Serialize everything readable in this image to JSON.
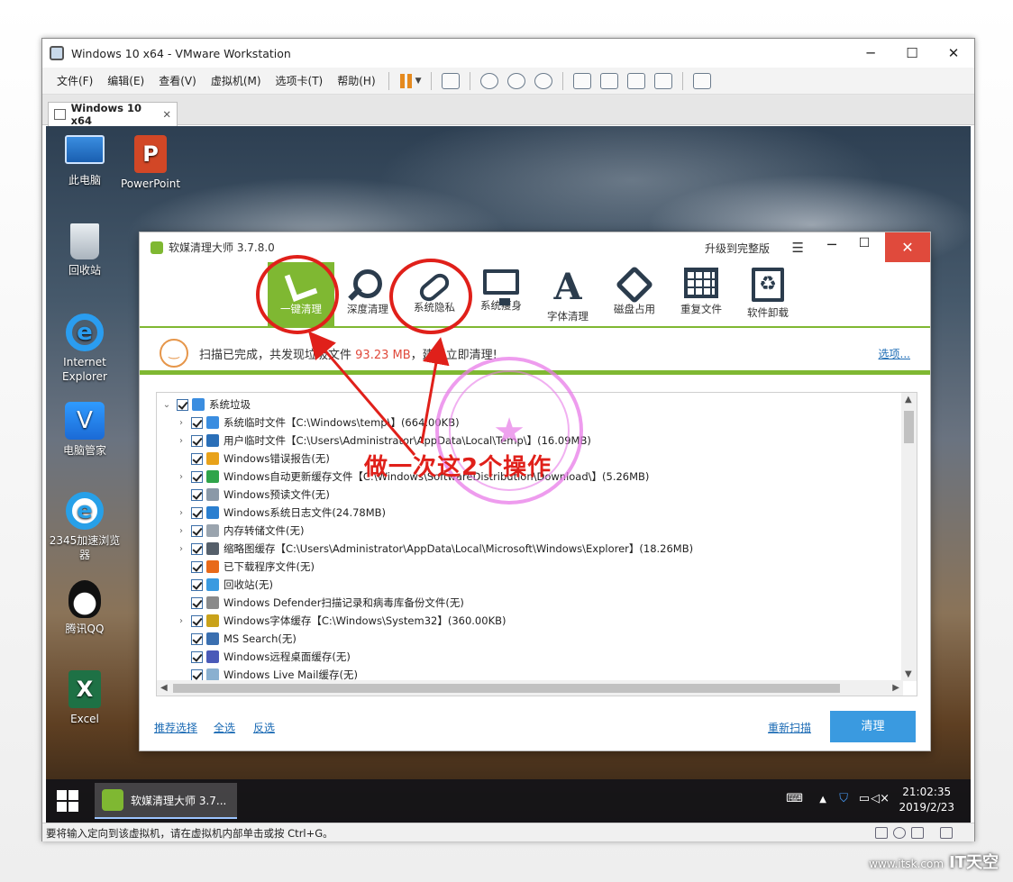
{
  "vmware": {
    "title": "Windows 10 x64 - VMware Workstation",
    "menus": [
      "文件(F)",
      "编辑(E)",
      "查看(V)",
      "虚拟机(M)",
      "选项卡(T)",
      "帮助(H)"
    ],
    "tab": "Windows 10 x64",
    "statusbar": "要将输入定向到该虚拟机，请在虚拟机内部单击或按 Ctrl+G。"
  },
  "desktop": {
    "icons": [
      {
        "label": "此电脑",
        "icon": "computer-icon"
      },
      {
        "label": "PowerPoint",
        "icon": "powerpoint-icon"
      },
      {
        "label": "回收站",
        "icon": "recycle-bin-icon"
      },
      {
        "label": "Internet Explorer",
        "icon": "ie-icon"
      },
      {
        "label": "电脑管家",
        "icon": "pc-manager-icon"
      },
      {
        "label": "2345加速浏览器",
        "icon": "2345-browser-icon"
      },
      {
        "label": "腾讯QQ",
        "icon": "qq-icon"
      },
      {
        "label": "Excel",
        "icon": "excel-icon"
      }
    ],
    "glyphs": {
      "ppt": "P",
      "ie": "e",
      "guard": "V",
      "b2345": "e",
      "xls": "X"
    }
  },
  "app": {
    "title": "软媒清理大师 3.7.8.0",
    "upgrade": "升级到完整版",
    "tools": [
      "一键清理",
      "深度清理",
      "系统隐私",
      "系统瘦身",
      "字体清理",
      "磁盘占用",
      "重复文件",
      "软件卸载"
    ],
    "status": {
      "prefix": "扫描已完成，共发现垃圾文件",
      "size": "93.23 MB",
      "suffix": "，建议立即清理!"
    },
    "options_link": "选项...",
    "tree": {
      "root": "系统垃圾",
      "items": [
        {
          "label": "系统临时文件【C:\\Windows\\temp\\】(664.00KB)",
          "expandable": true,
          "color": "#3a8de0"
        },
        {
          "label": "用户临时文件【C:\\Users\\Administrator\\AppData\\Local\\Temp\\】(16.09MB)",
          "expandable": true,
          "color": "#2a6fb8"
        },
        {
          "label": "Windows错误报告(无)",
          "expandable": false,
          "color": "#e8a21a"
        },
        {
          "label": "Windows自动更新缓存文件【C:\\Windows\\SoftwareDistribution\\Download\\】(5.26MB)",
          "expandable": true,
          "color": "#2fa44a"
        },
        {
          "label": "Windows预读文件(无)",
          "expandable": false,
          "color": "#8a99a8"
        },
        {
          "label": "Windows系统日志文件(24.78MB)",
          "expandable": true,
          "color": "#2a7fd0"
        },
        {
          "label": "内存转储文件(无)",
          "expandable": true,
          "color": "#9aa4ae"
        },
        {
          "label": "缩略图缓存【C:\\Users\\Administrator\\AppData\\Local\\Microsoft\\Windows\\Explorer】(18.26MB)",
          "expandable": true,
          "color": "#555f6a"
        },
        {
          "label": "已下载程序文件(无)",
          "expandable": false,
          "color": "#e86a1a"
        },
        {
          "label": "回收站(无)",
          "expandable": false,
          "color": "#3a9ae0"
        },
        {
          "label": "Windows Defender扫描记录和病毒库备份文件(无)",
          "expandable": false,
          "color": "#8a8a8a"
        },
        {
          "label": "Windows字体缓存【C:\\Windows\\System32】(360.00KB)",
          "expandable": true,
          "color": "#c9a21a"
        },
        {
          "label": "MS Search(无)",
          "expandable": false,
          "color": "#3a6fb0"
        },
        {
          "label": "Windows远程桌面缓存(无)",
          "expandable": false,
          "color": "#4a5ab8"
        },
        {
          "label": "Windows Live Mail缓存(无)",
          "expandable": false,
          "color": "#8ab0d0"
        }
      ]
    },
    "footer": {
      "recommend": "推荐选择",
      "select_all": "全选",
      "invert": "反选",
      "rescan": "重新扫描",
      "clean": "清理"
    }
  },
  "taskbar": {
    "task_label": "软媒清理大师 3.7...",
    "time": "21:02:35",
    "date": "2019/2/23"
  },
  "annotation": {
    "text": "做一次这2个操作",
    "color": "#e0201a"
  },
  "watermark": {
    "site": "www.itsk.com",
    "brand": "IT天空"
  }
}
